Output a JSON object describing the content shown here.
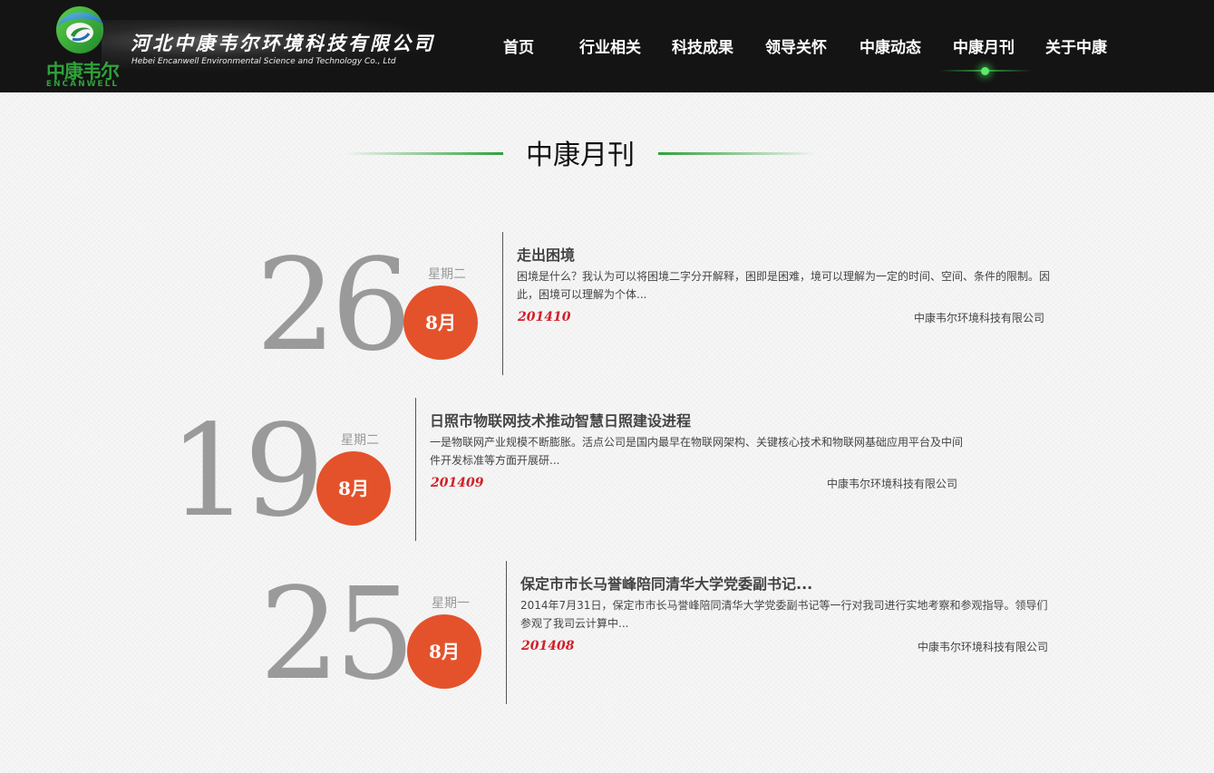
{
  "header": {
    "logo_cn": "中康韦尔",
    "logo_en": "ENCANWELL",
    "company_cn": "河北中康韦尔环境科技有限公司",
    "company_en": "Hebei Encanwell Environmental Science and Technology Co., Ltd",
    "nav": [
      {
        "label": "首页"
      },
      {
        "label": "行业相关"
      },
      {
        "label": "科技成果"
      },
      {
        "label": "领导关怀"
      },
      {
        "label": "中康动态"
      },
      {
        "label": "中康月刊"
      },
      {
        "label": "关于中康"
      }
    ],
    "active_nav": "中康月刊",
    "accent_color": "#2fa13b"
  },
  "section": {
    "title": "中康月刊"
  },
  "entries": [
    {
      "day": "26",
      "weekday": "星期二",
      "month": "8月",
      "title": "走出困境",
      "summary": "困境是什么？我认为可以将困境二字分开解释，困即是困难，境可以理解为一定的时间、空间、条件的限制。因此，困境可以理解为个体...",
      "issue": "201410",
      "source": "中康韦尔环境科技有限公司"
    },
    {
      "day": "19",
      "weekday": "星期二",
      "month": "8月",
      "title": "日照市物联网技术推动智慧日照建设进程",
      "summary": "一是物联网产业规模不断膨胀。活点公司是国内最早在物联网架构、关键核心技术和物联网基础应用平台及中间件开发标准等方面开展研...",
      "issue": "201409",
      "source": "中康韦尔环境科技有限公司"
    },
    {
      "day": "25",
      "weekday": "星期一",
      "month": "8月",
      "title": "保定市市长马誉峰陪同清华大学党委副书记...",
      "summary": "2014年7月31日，保定市市长马誉峰陪同清华大学党委副书记等一行对我司进行实地考察和参观指导。领导们参观了我司云计算中...",
      "issue": "201408",
      "source": "中康韦尔环境科技有限公司"
    }
  ],
  "colors": {
    "month_circle": "#e4522b",
    "issue_text": "#d0202a",
    "header_bg": "#141414"
  }
}
